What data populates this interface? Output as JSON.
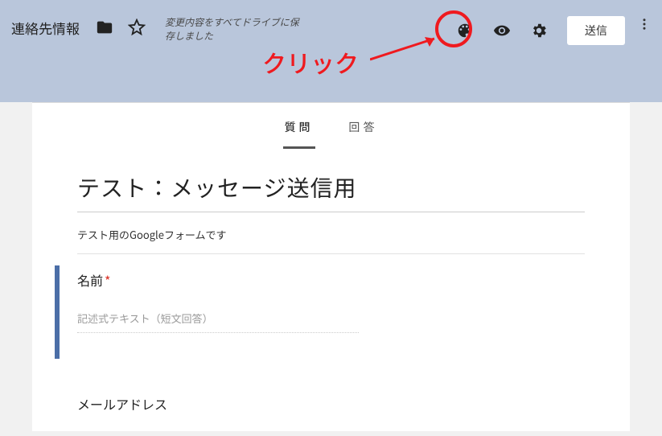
{
  "header": {
    "form_name": "連絡先情報",
    "save_status": "変更内容をすべてドライブに保存しました",
    "send_label": "送信"
  },
  "annotation": {
    "click_label": "クリック"
  },
  "tabs": {
    "questions": "質問",
    "responses": "回答"
  },
  "form": {
    "title": "テスト：メッセージ送信用",
    "description": "テスト用のGoogleフォームです",
    "q1_label": "名前",
    "q1_required_mark": "*",
    "q1_placeholder": "記述式テキスト（短文回答）",
    "q2_label": "メールアドレス"
  },
  "colors": {
    "header_bg": "#b9c6db",
    "accent": "#4b6ea7",
    "annotation_red": "#ef1a1f"
  }
}
